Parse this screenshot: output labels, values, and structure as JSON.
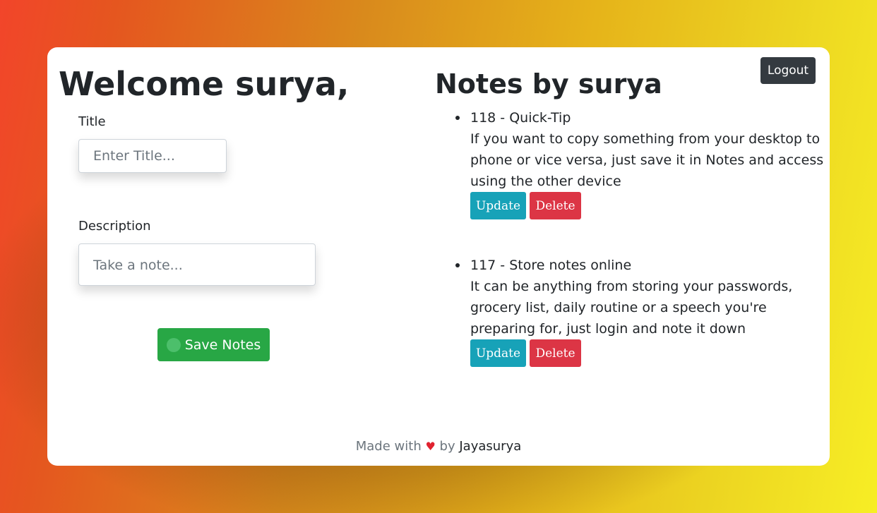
{
  "header": {
    "welcome": "Welcome surya,",
    "logout_label": "Logout"
  },
  "form": {
    "title_label": "Title",
    "title_placeholder": "Enter Title...",
    "description_label": "Description",
    "description_placeholder": "Take a note...",
    "save_label": "Save Notes"
  },
  "notes": {
    "heading": "Notes by surya",
    "items": [
      {
        "title": "118 - Quick-Tip",
        "description": "If you want to copy something from your desktop to phone or vice versa, just save it in Notes and access using the other device",
        "update_label": "Update",
        "delete_label": "Delete"
      },
      {
        "title": "117 - Store notes online",
        "description": "It can be anything from storing your passwords, grocery list, daily routine or a speech you're preparing for, just login and note it down",
        "update_label": "Update",
        "delete_label": "Delete"
      }
    ]
  },
  "footer": {
    "made_with": "Made with",
    "heart": "♥",
    "by": "by",
    "author": "Jayasurya"
  },
  "colors": {
    "save": "#28a745",
    "update": "#17a2b8",
    "delete": "#dc3545",
    "logout": "#343a40",
    "heart": "#e0222f"
  }
}
